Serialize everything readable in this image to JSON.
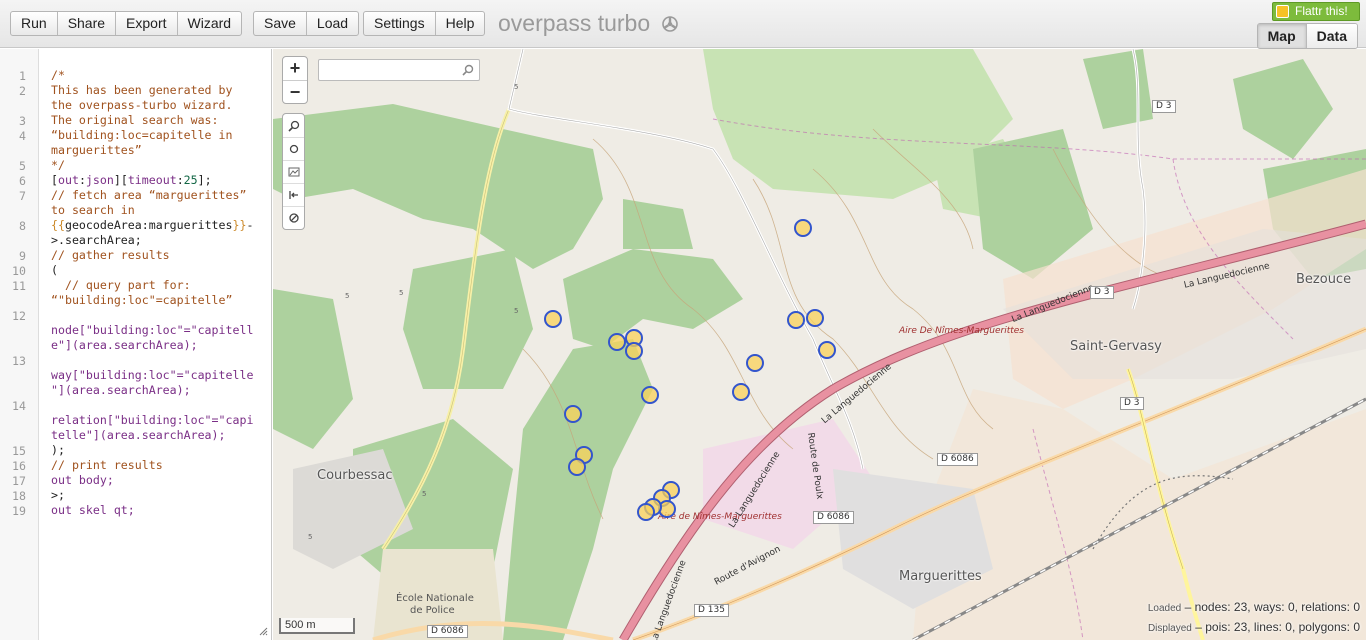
{
  "toolbar": {
    "groups": [
      [
        "Run",
        "Share",
        "Export",
        "Wizard"
      ],
      [
        "Save",
        "Load"
      ],
      [
        "Settings",
        "Help"
      ]
    ],
    "app_title": "overpass turbo",
    "flattr_label": "Flattr this!",
    "view_tabs": {
      "map": "Map",
      "data": "Data"
    }
  },
  "editor": {
    "line_numbers": [
      "1",
      "2",
      "3",
      "4",
      "5",
      "6",
      "7",
      "8",
      "9",
      "10",
      "11",
      "12",
      "13",
      "14",
      "15",
      "16",
      "17",
      "18",
      "19"
    ],
    "lines": [
      "/*",
      "This has been generated by",
      "the overpass-turbo wizard.",
      "The original search was:",
      "“building:loc=capitelle in",
      "marguerittes”",
      "*/",
      "[out:json][timeout:25];",
      "// fetch area “marguerittes”",
      "to search in",
      "{{geocodeArea:marguerittes}}-",
      ">.searchArea;",
      "// gather results",
      "(",
      "  // query part for:",
      "“\"building:loc\"=capitelle”",
      "",
      "node[\"building:loc\"=\"capitell",
      "e\"](area.searchArea);",
      "",
      "way[\"building:loc\"=\"capitelle",
      "\"](area.searchArea);",
      "",
      "relation[\"building:loc\"=\"capi",
      "telle\"](area.searchArea);",
      ");",
      "// print results",
      "out body;",
      ">;",
      "out skel qt;"
    ]
  },
  "map": {
    "zoom_in": "+",
    "zoom_out": "−",
    "search_placeholder": "",
    "scale_label": "500 m",
    "places": {
      "courbessac": "Courbessac",
      "saint_gervasy": "Saint-Gervasy",
      "bezouce": "Bezouce",
      "marguerittes": "Marguerittes",
      "ecole": "École Nationale",
      "police": "de Police"
    },
    "services": {
      "aire_north": "Aire De Nîmes-Marguerittes",
      "aire_south": "Aire de Nîmes-Marguerittes"
    },
    "roads": {
      "languedocienne": "La Languedocienne",
      "route_poulx": "Route de Poulx",
      "route_avignon": "Route d'Avignon"
    },
    "shields": {
      "d3": "D 3",
      "d6086": "D 6086",
      "d135": "D 135"
    },
    "trail_marks": [
      "5"
    ],
    "icons": [
      "search-icon",
      "zoom-to-data-icon",
      "locate-icon",
      "toggle-data-icon",
      "panel-icon",
      "clear-icon"
    ],
    "colors": {
      "forest": "#add19e",
      "scrub": "#c8d7ab",
      "motorway": "#e891a1",
      "marker_stroke": "#3355cc",
      "marker_fill": "#fad25a"
    }
  },
  "stats": {
    "loaded_label": "Loaded",
    "loaded_value": "– nodes: 23, ways: 0, relations: 0",
    "displayed_label": "Displayed",
    "displayed_value": "– pois: 23, lines: 0, polygons: 0"
  }
}
